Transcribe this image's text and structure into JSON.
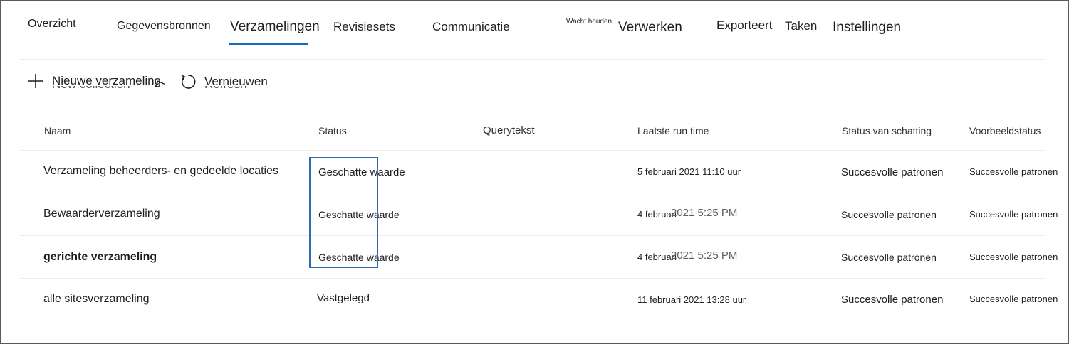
{
  "tabs": [
    {
      "label": "Overzicht"
    },
    {
      "label": "Gegevensbronnen"
    },
    {
      "label": "Verzamelingen"
    },
    {
      "label": "Revisiesets"
    },
    {
      "label": "Communicatie"
    },
    {
      "label": "Wacht houden"
    },
    {
      "label": "Verwerken"
    },
    {
      "label": "Exporteert"
    },
    {
      "label": "Taken"
    },
    {
      "label": "Instellingen"
    }
  ],
  "commands": {
    "new_label": "Nieuwe verzameling",
    "new_ghost": "New collection",
    "refresh_label": "Vernieuwen",
    "refresh_ghost": "Refresh"
  },
  "columns": [
    "Naam",
    "Status",
    "Querytekst",
    "Laatste run time",
    "Status van schatting",
    "Voorbeeldstatus"
  ],
  "rows": [
    {
      "name": "Verzameling beheerders- en gedeelde locaties",
      "status": "Geschatte waarde",
      "query": "",
      "last_run": "5 februari 2021 11:10 uur",
      "estimate": "Succesvolle patronen",
      "preview": "Succesvolle patronen"
    },
    {
      "name": "Bewaarderverzameling",
      "status": "Geschatte waarde",
      "query": "",
      "last_run": "4 februari",
      "last_run_ghost": "2021 5:25 PM",
      "estimate": "Succesvolle patronen",
      "preview": "Succesvolle patronen"
    },
    {
      "name": "gerichte verzameling",
      "status": "Geschatte waarde",
      "query": "",
      "last_run": "4 februari",
      "last_run_ghost": "2021 5:25 PM",
      "estimate": "Succesvolle patronen",
      "preview": "Succesvolle patronen"
    },
    {
      "name": "alle sitesverzameling",
      "status": "Vastgelegd",
      "query": "",
      "last_run": "11 februari 2021 13:28 uur",
      "estimate": "Succesvolle patronen",
      "preview": "Succesvolle patronen"
    }
  ],
  "colors": {
    "accent": "#0f6cbd",
    "highlight_box": "#2b6cb0",
    "divider": "#edebe9"
  }
}
